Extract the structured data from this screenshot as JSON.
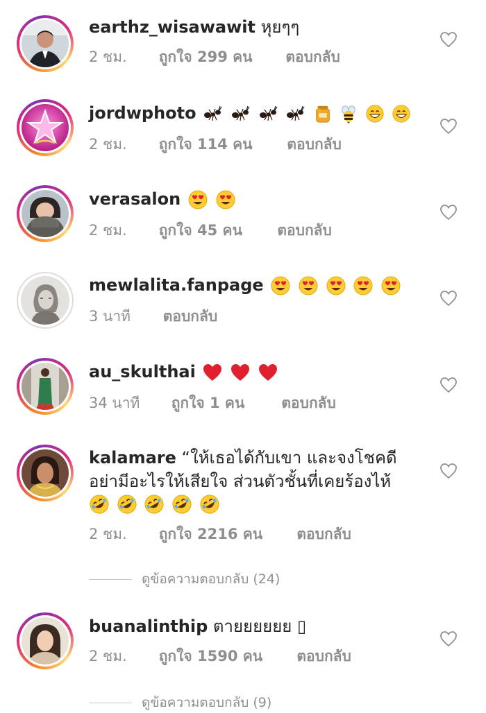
{
  "comments": [
    {
      "username": "earthz_wisawawit",
      "text": "หุยๆๆ",
      "time": "2 ชม.",
      "likes": "ถูกใจ 299 คน",
      "reply": "ตอบกลับ"
    },
    {
      "username": "jordwphoto",
      "emojis": [
        "ant",
        "ant",
        "ant",
        "ant",
        "honey-pot",
        "bee",
        "grin",
        "grin"
      ],
      "time": "2 ชม.",
      "likes": "ถูกใจ 114 คน",
      "reply": "ตอบกลับ"
    },
    {
      "username": "verasalon",
      "emojis": [
        "heart-eyes",
        "heart-eyes"
      ],
      "time": "2 ชม.",
      "likes": "ถูกใจ 45 คน",
      "reply": "ตอบกลับ"
    },
    {
      "username": "mewlalita.fanpage",
      "emojis": [
        "heart-eyes",
        "heart-eyes",
        "heart-eyes",
        "heart-eyes",
        "heart-eyes"
      ],
      "time": "3 นาที",
      "reply": "ตอบกลับ"
    },
    {
      "username": "au_skulthai",
      "emojis": [
        "red-heart",
        "red-heart",
        "red-heart"
      ],
      "time": "34 นาที",
      "likes": "ถูกใจ 1 คน",
      "reply": "ตอบกลับ"
    },
    {
      "username": "kalamare",
      "text_line1": "“ให้เธอได้กับเขา และจงโชคดี",
      "text_line2": "อย่ามีอะไรให้เสียใจ ส่วนตัวชั้นที่เคยร้องไห้",
      "emojis": [
        "rofl",
        "rofl",
        "rofl",
        "rofl",
        "rofl"
      ],
      "time": "2 ชม.",
      "likes": "ถูกใจ 2216 คน",
      "reply": "ตอบกลับ",
      "view_replies": "ดูข้อความตอบกลับ (24)"
    },
    {
      "username": "buanalinthip",
      "text": "ตายยยยยย ",
      "trailing_glyph": "▯",
      "time": "2 ชม.",
      "likes": "ถูกใจ 1590 คน",
      "reply": "ตอบกลับ",
      "view_replies": "ดูข้อความตอบกลับ (9)"
    }
  ],
  "icons": {
    "like": "heart-outline-icon"
  },
  "colors": {
    "text": "#262626",
    "muted": "#8e8e8e",
    "ring_start": "#f58529",
    "ring_end": "#8134af",
    "heart_red": "#e0202f",
    "emoji_yellow": "#ffcc33"
  }
}
